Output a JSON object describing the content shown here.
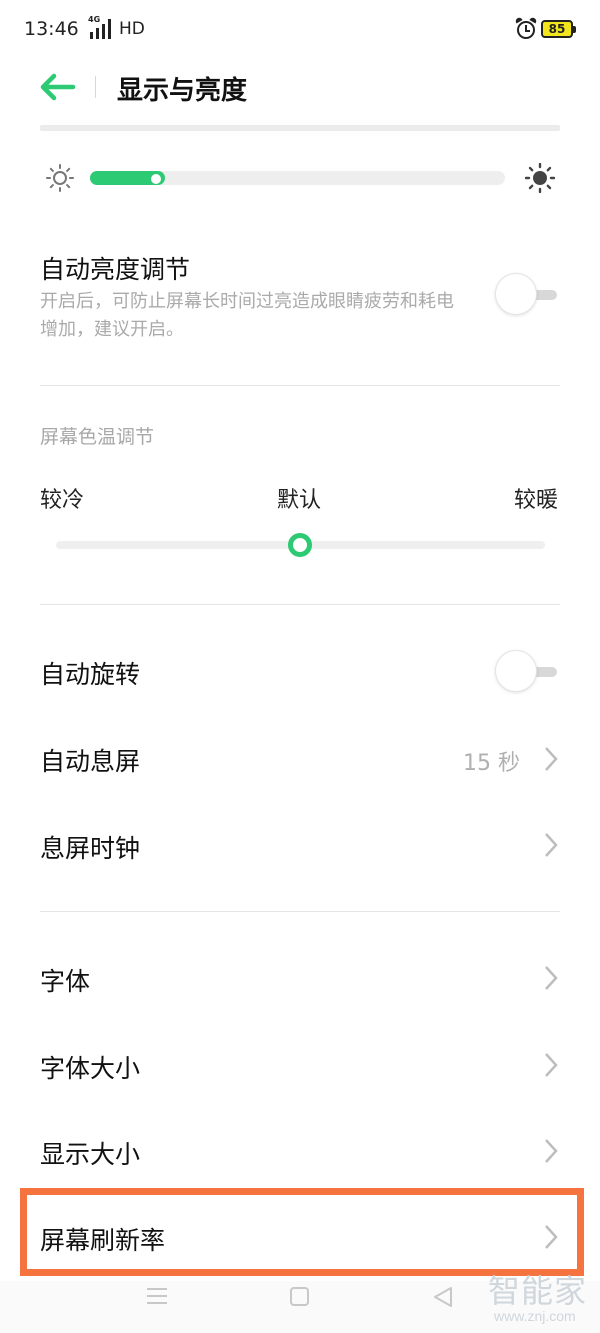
{
  "status_bar": {
    "time": "13:46",
    "network": "4G",
    "hd": "HD",
    "battery": "85",
    "battery_color": "#f2e51c"
  },
  "header": {
    "back_icon": "arrow-left-icon",
    "title": "显示与亮度"
  },
  "brightness": {
    "low_icon": "sun-outline-icon",
    "high_icon": "sun-filled-icon",
    "level": 0.18,
    "accent": "#2cca73"
  },
  "auto_brightness": {
    "title": "自动亮度调节",
    "description": "开启后，可防止屏幕长时间过亮造成眼睛疲劳和耗电增加，建议开启。",
    "enabled": false
  },
  "color_temperature": {
    "section_label": "屏幕色温调节",
    "cool_label": "较冷",
    "default_label": "默认",
    "warm_label": "较暖",
    "level": 0.5
  },
  "auto_rotate": {
    "title": "自动旋转",
    "enabled": false
  },
  "auto_screen_off": {
    "title": "自动息屏",
    "value": "15 秒"
  },
  "screen_off_clock": {
    "title": "息屏时钟"
  },
  "font": {
    "title": "字体"
  },
  "font_size": {
    "title": "字体大小"
  },
  "display_size": {
    "title": "显示大小"
  },
  "refresh_rate": {
    "title": "屏幕刷新率",
    "highlight_color": "#f4733f"
  },
  "nav_bar": {
    "menu_icon": "menu-icon",
    "home_icon": "home-square-icon",
    "back_icon": "triangle-back-icon"
  },
  "watermark": {
    "main": "智能家",
    "sub": "www.znj.com"
  }
}
